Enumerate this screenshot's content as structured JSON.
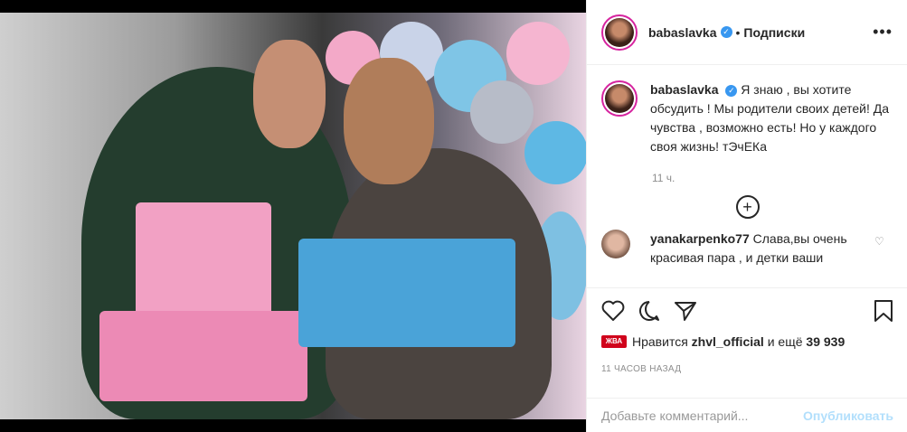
{
  "post": {
    "username": "babaslavka",
    "separator": "•",
    "follow_label": "Подписки",
    "more_icon": "more-icon",
    "caption_text": "Я знаю , вы хотите обсудить ! Мы родители своих детей! Да чувства , возможно есть! Но у каждого своя жизнь! тЭчЕКа",
    "caption_time": "11 ч.",
    "load_more_icon": "plus-circle-icon"
  },
  "comment": {
    "username": "yanakarpenko77",
    "text": "Слава,вы очень красивая пара , и детки ваши"
  },
  "likes": {
    "badge": "ЖВА",
    "prefix": "Нравится",
    "user": "zhvl_official",
    "middle": "и ещё",
    "count": "39 939"
  },
  "timestamp": "11 ЧАСОВ НАЗАД",
  "add_comment": {
    "placeholder": "Добавьте комментарий...",
    "publish": "Опубликовать"
  },
  "colors": {
    "verified": "#3897f0",
    "publish_disabled": "#b2dffc",
    "text": "#262626",
    "muted": "#8e8e8e"
  }
}
